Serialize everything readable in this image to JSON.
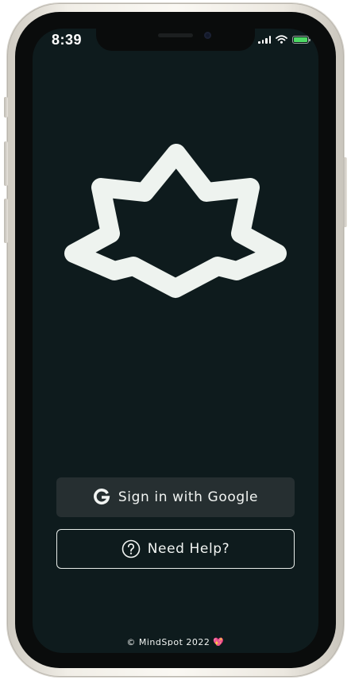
{
  "status_bar": {
    "time": "8:39",
    "battery_level": 1.0
  },
  "app": {
    "logo_icon": "lotus-star-outline-icon"
  },
  "actions": {
    "google_label": "Sign in with Google",
    "help_label": "Need Help?"
  },
  "footer": {
    "copyright": "© MindSpot 2022",
    "heart": "💖"
  },
  "colors": {
    "background": "#0e1b1d",
    "foreground": "#f2f5f3",
    "google_button_bg": "#262f31",
    "battery": "#4cd964"
  }
}
